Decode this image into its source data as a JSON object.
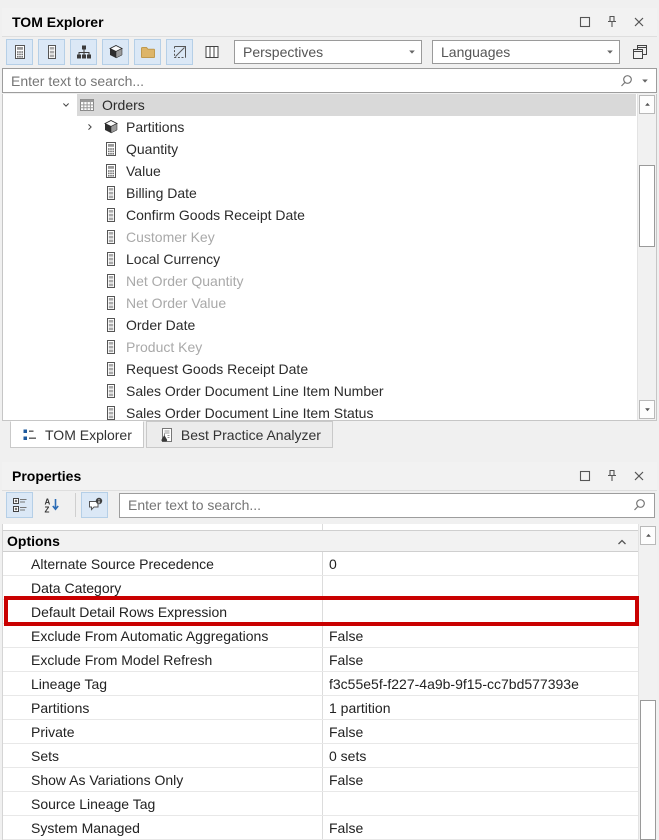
{
  "colors": {
    "toggle_bg": "#dbe8f6",
    "toggle_border": "#b5cfe7",
    "selection_gray": "#d9d9d9",
    "muted_text": "#a9a9a9",
    "annotation_red": "#c90000",
    "folder_tan": "#ddb569",
    "tab_icon_blue": "#1e5a9e"
  },
  "tom_explorer": {
    "title": "TOM Explorer",
    "toolbar": {
      "buttons": [
        {
          "icon": "measure-icon",
          "name": "toggle-measures-button",
          "toggled": true
        },
        {
          "icon": "column-icon",
          "name": "toggle-columns-button",
          "toggled": true
        },
        {
          "icon": "hierarchy-icon",
          "name": "toggle-hierarchies-button",
          "toggled": true
        },
        {
          "icon": "cube-icon",
          "name": "toggle-partitions-button",
          "toggled": true
        },
        {
          "icon": "folder-icon",
          "name": "toggle-display-folders-button",
          "toggled": true
        },
        {
          "icon": "hidden-icon",
          "name": "toggle-hidden-objects-button",
          "toggled": true
        },
        {
          "icon": "column-view-icon",
          "name": "toggle-column-view-button",
          "toggled": false
        }
      ],
      "perspectives_label": "Perspectives",
      "languages_label": "Languages"
    },
    "search_placeholder": "Enter text to search...",
    "tree": [
      {
        "label": "Orders",
        "icon": "table-icon",
        "level": 0,
        "chevron": "expanded",
        "selected": true
      },
      {
        "label": "Partitions",
        "icon": "cube-icon",
        "level": 1,
        "chevron": "collapsed"
      },
      {
        "label": "Quantity",
        "icon": "measure-icon",
        "level": 1
      },
      {
        "label": "Value",
        "icon": "measure-icon",
        "level": 1
      },
      {
        "label": "Billing Date",
        "icon": "column-icon",
        "level": 1
      },
      {
        "label": "Confirm Goods Receipt Date",
        "icon": "column-icon",
        "level": 1
      },
      {
        "label": "Customer Key",
        "icon": "column-icon",
        "level": 1,
        "muted": true
      },
      {
        "label": "Local Currency",
        "icon": "column-icon",
        "level": 1
      },
      {
        "label": "Net Order Quantity",
        "icon": "column-icon",
        "level": 1,
        "muted": true
      },
      {
        "label": "Net Order Value",
        "icon": "column-icon",
        "level": 1,
        "muted": true
      },
      {
        "label": "Order Date",
        "icon": "column-icon",
        "level": 1
      },
      {
        "label": "Product Key",
        "icon": "column-icon",
        "level": 1,
        "muted": true
      },
      {
        "label": "Request Goods Receipt Date",
        "icon": "column-icon",
        "level": 1
      },
      {
        "label": "Sales Order Document Line Item Number",
        "icon": "column-icon",
        "level": 1
      },
      {
        "label": "Sales Order Document Line Item Status",
        "icon": "column-icon",
        "level": 1
      }
    ],
    "tabs": [
      {
        "label": "TOM Explorer",
        "icon": "tom-tab-icon",
        "active": true
      },
      {
        "label": "Best Practice Analyzer",
        "icon": "bpa-tab-icon",
        "active": false
      }
    ]
  },
  "properties": {
    "title": "Properties",
    "toolbar_buttons": [
      {
        "icon": "categorized-icon",
        "name": "categorized-view-button",
        "toggled": true
      },
      {
        "icon": "sort-az-icon",
        "name": "alphabetical-sort-button",
        "toggled": false
      },
      {
        "icon": "callout-icon",
        "name": "property-description-button",
        "toggled": true
      }
    ],
    "search_placeholder": "Enter text to search...",
    "section_label": "Options",
    "rows": [
      {
        "name": "Alternate Source Precedence",
        "value": "0"
      },
      {
        "name": "Data Category",
        "value": ""
      },
      {
        "name": "Default Detail Rows Expression",
        "value": "",
        "highlighted": true
      },
      {
        "name": "Exclude From Automatic Aggregations",
        "value": "False"
      },
      {
        "name": "Exclude From Model Refresh",
        "value": "False"
      },
      {
        "name": "Lineage Tag",
        "value": "f3c55e5f-f227-4a9b-9f15-cc7bd577393e"
      },
      {
        "name": "Partitions",
        "value": "1 partition"
      },
      {
        "name": "Private",
        "value": "False"
      },
      {
        "name": "Sets",
        "value": "0 sets"
      },
      {
        "name": "Show As Variations Only",
        "value": "False"
      },
      {
        "name": "Source Lineage Tag",
        "value": ""
      },
      {
        "name": "System Managed",
        "value": "False"
      }
    ]
  }
}
